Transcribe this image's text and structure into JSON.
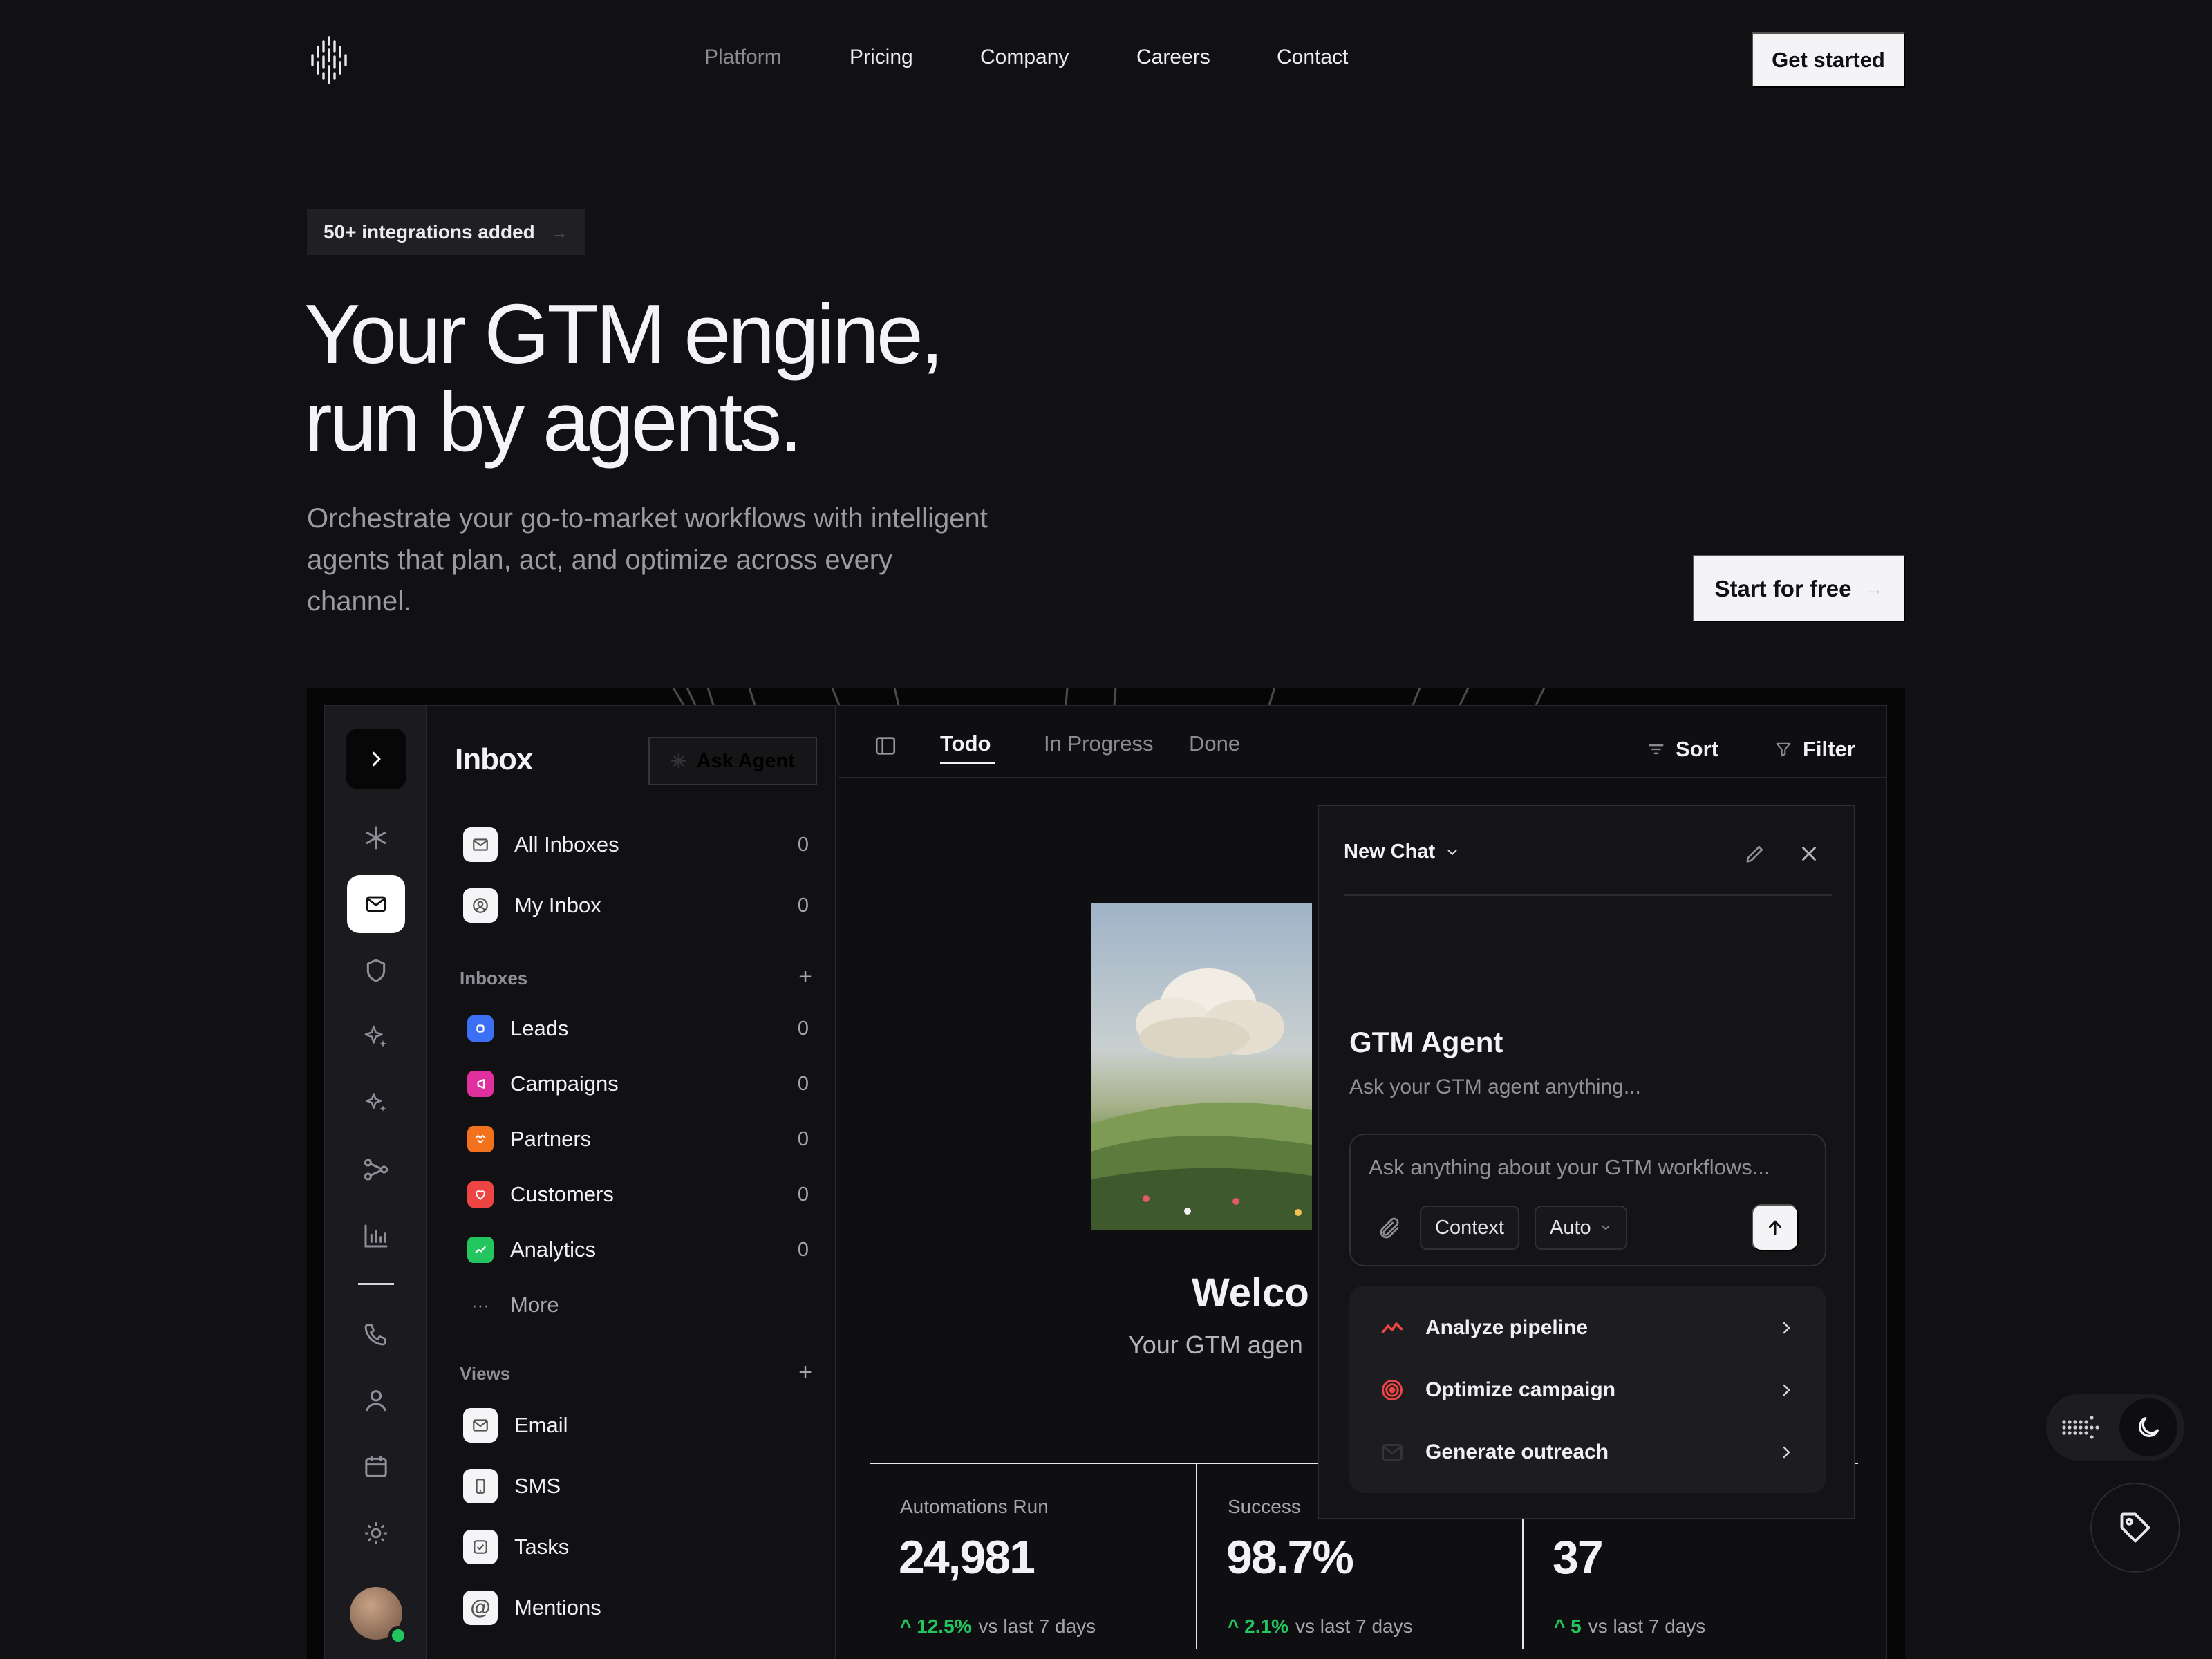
{
  "nav": {
    "links": [
      "Platform",
      "Pricing",
      "Company",
      "Careers",
      "Contact"
    ],
    "cta": "Get started"
  },
  "hero": {
    "badge": "50+ integrations added",
    "title_line1": "Your GTM engine,",
    "title_line2": "run by agents.",
    "subtitle": "Orchestrate your go-to-market workflows with intelligent agents that plan, act, and optimize across every channel.",
    "cta": "Start for free"
  },
  "inbox": {
    "title": "Inbox",
    "ask_agent": "Ask Agent",
    "top_items": [
      {
        "label": "All Inboxes",
        "count": "0"
      },
      {
        "label": "My Inbox",
        "count": "0"
      }
    ],
    "inboxes_header": "Inboxes",
    "inboxes": [
      {
        "label": "Leads",
        "count": "0",
        "color": "#3b6ff5"
      },
      {
        "label": "Campaigns",
        "count": "0",
        "color": "#e0309e"
      },
      {
        "label": "Partners",
        "count": "0",
        "color": "#f2711c"
      },
      {
        "label": "Customers",
        "count": "0",
        "color": "#ef4444"
      },
      {
        "label": "Analytics",
        "count": "0",
        "color": "#22c55e"
      }
    ],
    "more": "More",
    "views_header": "Views",
    "views": [
      {
        "label": "Email"
      },
      {
        "label": "SMS"
      },
      {
        "label": "Tasks"
      },
      {
        "label": "Mentions"
      }
    ]
  },
  "main": {
    "tabs": [
      "Todo",
      "In Progress",
      "Done"
    ],
    "sort": "Sort",
    "filter": "Filter",
    "welcome": "Welco",
    "welcome_sub": "Your GTM agen",
    "stats": [
      {
        "label": "Automations Run",
        "value": "24,981",
        "delta": "12.5%",
        "vs": "vs last 7 days"
      },
      {
        "label": "Success",
        "value": "98.7%",
        "delta": "2.1%",
        "vs": "vs last 7 days"
      },
      {
        "label": "",
        "value": "37",
        "delta": "5",
        "vs": "vs last 7 days"
      }
    ]
  },
  "chat": {
    "title": "New Chat",
    "agent_title": "GTM Agent",
    "agent_sub": "Ask your GTM agent anything...",
    "placeholder": "Ask anything about your GTM workflows...",
    "context": "Context",
    "mode": "Auto",
    "actions": [
      "Analyze pipeline",
      "Optimize campaign",
      "Generate outreach"
    ]
  },
  "colors": {
    "background": "#111114",
    "success": "#22c55e",
    "accent_red": "#ef4444"
  }
}
